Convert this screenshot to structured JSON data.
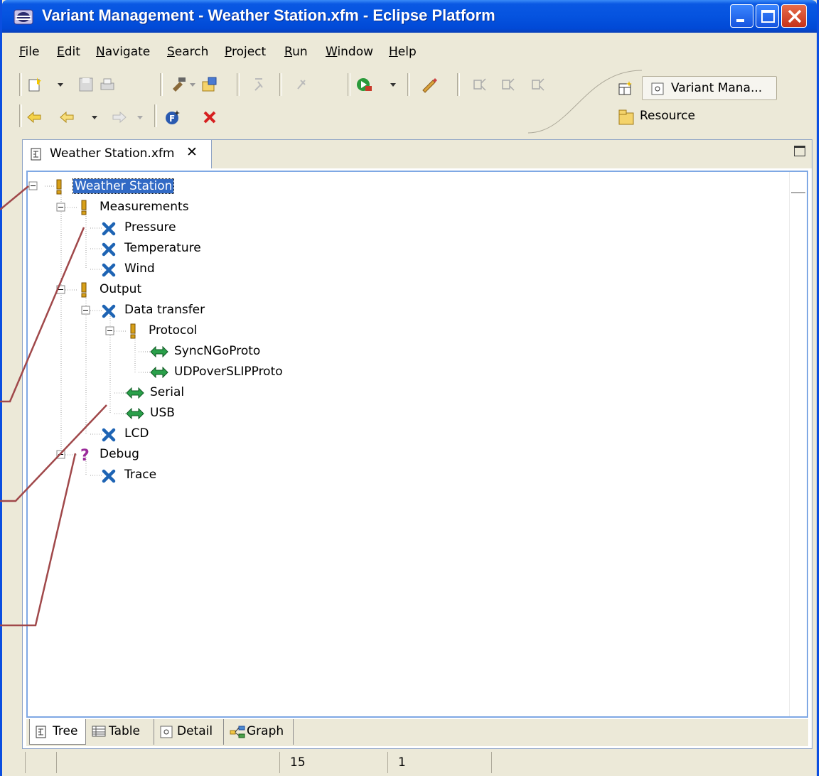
{
  "window": {
    "title": "Variant Management - Weather Station.xfm - Eclipse Platform"
  },
  "menu": [
    "File",
    "Edit",
    "Navigate",
    "Search",
    "Project",
    "Run",
    "Window",
    "Help"
  ],
  "perspectives": {
    "active": "Variant Mana...",
    "other": "Resource"
  },
  "editor_tab": {
    "title": "Weather Station.xfm",
    "close": "✕"
  },
  "tree": [
    {
      "label": "Weather Station",
      "icon": "mandatory-icon"
    },
    {
      "label": "Measurements",
      "icon": "mandatory-icon"
    },
    {
      "label": "Pressure",
      "icon": "optional-icon"
    },
    {
      "label": "Temperature",
      "icon": "optional-icon"
    },
    {
      "label": "Wind",
      "icon": "optional-icon"
    },
    {
      "label": "Output",
      "icon": "mandatory-icon"
    },
    {
      "label": "Data transfer",
      "icon": "optional-icon"
    },
    {
      "label": "Protocol",
      "icon": "mandatory-icon"
    },
    {
      "label": "SyncNGoProto",
      "icon": "alternative-icon"
    },
    {
      "label": "UDPoverSLIPProto",
      "icon": "alternative-icon"
    },
    {
      "label": "Serial",
      "icon": "alternative-icon"
    },
    {
      "label": "USB",
      "icon": "alternative-icon"
    },
    {
      "label": "LCD",
      "icon": "optional-icon"
    },
    {
      "label": "Debug",
      "icon": "unknown-icon"
    },
    {
      "label": "Trace",
      "icon": "optional-icon"
    }
  ],
  "bottom_tabs": [
    "Tree",
    "Table",
    "Detail",
    "Graph"
  ],
  "status": {
    "cell1": "15",
    "cell2": "1"
  },
  "colors": {
    "title_blue": "#0553df",
    "selection": "#316ac5",
    "annotation": "#a0484a",
    "optional": "#1e64b4",
    "alternative": "#1a8a3a"
  }
}
